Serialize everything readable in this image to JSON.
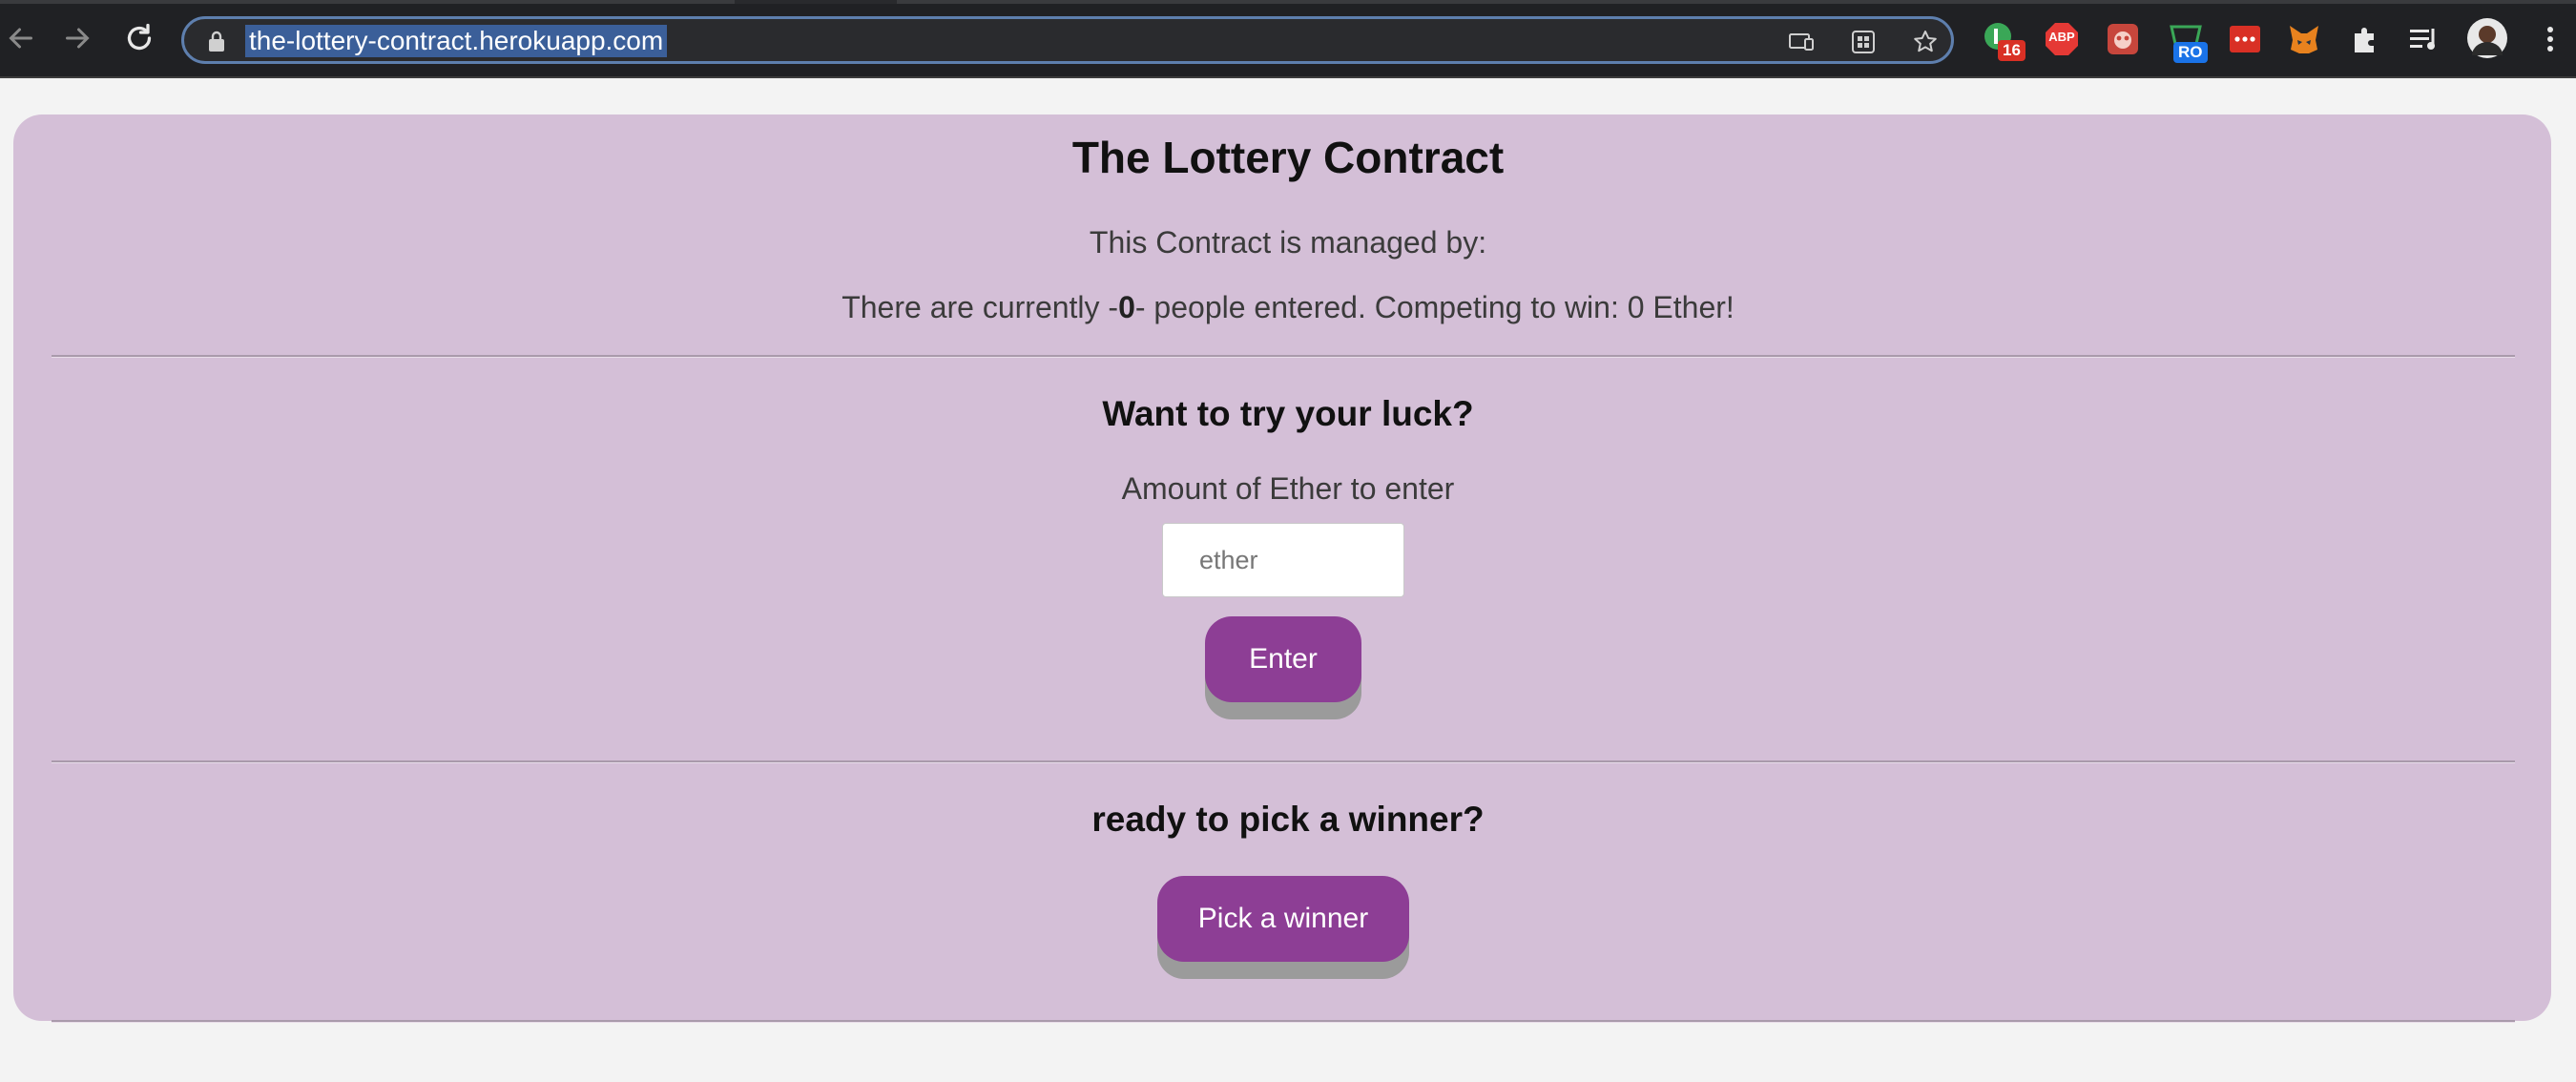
{
  "browser": {
    "url": "the-lottery-contract.herokuapp.com",
    "extensions": [
      {
        "name": "extension-badge-16",
        "badge": "16"
      },
      {
        "name": "adblock-plus",
        "label": "ABP"
      },
      {
        "name": "extension-red-bug",
        "label": ""
      },
      {
        "name": "extension-ro",
        "badge": "RO"
      },
      {
        "name": "extension-red-dots",
        "label": ""
      },
      {
        "name": "metamask",
        "label": ""
      }
    ]
  },
  "page": {
    "title": "The Lottery Contract",
    "managed_by": "This Contract is managed by:",
    "players_prefix": "There are currently -",
    "players_count": "0",
    "players_suffix": "- people entered. Competing to win: 0 Ether!",
    "try_luck_heading": "Want to try your luck?",
    "amount_label": "Amount of Ether to enter",
    "amount_placeholder": "ether",
    "enter_button": "Enter",
    "pick_heading": "ready to pick a winner?",
    "pick_button": "Pick a winner"
  },
  "colors": {
    "card_background": "#d4bfd7",
    "button": "#8d3e95",
    "button_shadow": "#9b9b9b",
    "page_background": "#f3f3f3"
  }
}
